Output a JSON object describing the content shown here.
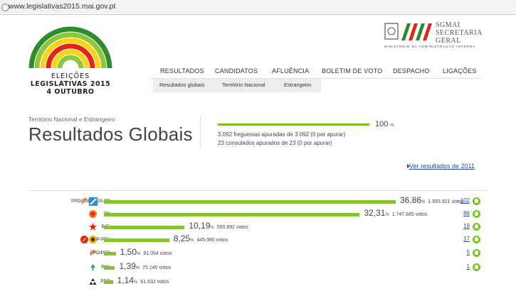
{
  "browser": {
    "url": "www.legislativas2015.mai.gov.pt"
  },
  "logo": {
    "line1": "ELEIÇÕES",
    "line2": "LEGISLATIVAS 2015",
    "line3": "4 OUTUBRO"
  },
  "sgmai": {
    "line1": "SGMAI",
    "line2": "SECRETARIA",
    "line3": "GERAL",
    "ministry": "MINISTÉRIO DA ADMINISTRAÇÃO INTERNA"
  },
  "nav": [
    "RESULTADOS",
    "CANDIDATOS",
    "AFLUÊNCIA",
    "BOLETIM DE VOTO",
    "DESPACHO",
    "LIGAÇÕES"
  ],
  "subnav": [
    "Resultados globais",
    "Território Nacional",
    "Estrangeiro"
  ],
  "page": {
    "crumb": "Território Nacional e Estrangeiro",
    "title": "Resultados Globais",
    "progress_pct": "100",
    "progress_unit": "%",
    "progress_line1": "3.092 freguesias apuradas de 3.092 (0 por apurar)",
    "progress_line2": "23 consulados apurados de 23 (0 por apurar)",
    "link_2011": "Ver resultados de 2011"
  },
  "results": [
    {
      "party": "PPD/PSD.CDS-PP",
      "pct": "36,86",
      "votes": "1.993.921 votos",
      "seats": "102",
      "share": 36.86
    },
    {
      "party": "PS",
      "pct": "32,31",
      "votes": "1.747.685 votos",
      "seats": "86",
      "share": 32.31
    },
    {
      "party": "B.E.",
      "pct": "10,19",
      "votes": "550.892 votos",
      "seats": "19",
      "share": 10.19
    },
    {
      "party": "PCP-PEV",
      "pct": "8,25",
      "votes": "445.980 votos",
      "seats": "17",
      "share": 8.25
    },
    {
      "party": "PPD/PSD",
      "pct": "1,50",
      "votes": "81.054 votos",
      "seats": "5",
      "share": 1.5
    },
    {
      "party": "PAN",
      "pct": "1,39",
      "votes": "75.140 votos",
      "seats": "1",
      "share": 1.39
    },
    {
      "party": "PDR",
      "pct": "1,14",
      "votes": "61.632 votos",
      "seats": "",
      "share": 1.14
    }
  ],
  "colors": {
    "accent_green": "#7cbf2a",
    "link_blue": "#2a4d8f"
  }
}
